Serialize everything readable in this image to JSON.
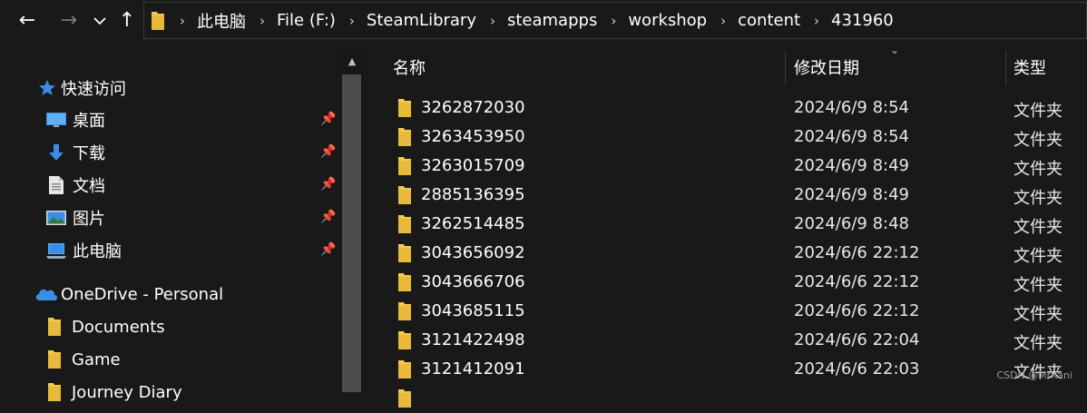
{
  "nav": {
    "back": "←",
    "forward": "→",
    "recent": "⌄",
    "up": "↑"
  },
  "breadcrumb": [
    "此电脑",
    "File (F:)",
    "SteamLibrary",
    "steamapps",
    "workshop",
    "content",
    "431960"
  ],
  "sidebar": {
    "quick_access": "快速访问",
    "pinned": [
      {
        "label": "桌面",
        "icon": "desktop-icon"
      },
      {
        "label": "下载",
        "icon": "download-icon"
      },
      {
        "label": "文档",
        "icon": "document-icon"
      },
      {
        "label": "图片",
        "icon": "picture-icon"
      },
      {
        "label": "此电脑",
        "icon": "computer-icon"
      }
    ],
    "onedrive": "OneDrive - Personal",
    "onedrive_items": [
      "Documents",
      "Game",
      "Journey Diary"
    ]
  },
  "columns": {
    "name": "名称",
    "date": "修改日期",
    "type": "类型"
  },
  "files": [
    {
      "name": "3262872030",
      "date": "2024/6/9 8:54",
      "type": "文件夹"
    },
    {
      "name": "3263453950",
      "date": "2024/6/9 8:54",
      "type": "文件夹"
    },
    {
      "name": "3263015709",
      "date": "2024/6/9 8:49",
      "type": "文件夹"
    },
    {
      "name": "2885136395",
      "date": "2024/6/9 8:49",
      "type": "文件夹"
    },
    {
      "name": "3262514485",
      "date": "2024/6/9 8:48",
      "type": "文件夹"
    },
    {
      "name": "3043656092",
      "date": "2024/6/6 22:12",
      "type": "文件夹"
    },
    {
      "name": "3043666706",
      "date": "2024/6/6 22:12",
      "type": "文件夹"
    },
    {
      "name": "3043685115",
      "date": "2024/6/6 22:12",
      "type": "文件夹"
    },
    {
      "name": "3121422498",
      "date": "2024/6/6 22:04",
      "type": "文件夹"
    },
    {
      "name": "3121412091",
      "date": "2024/6/6 22:03",
      "type": "文件夹"
    }
  ],
  "watermark": "CSDN @MrKani",
  "colors": {
    "background": "#191919",
    "folder": "#f2c94c",
    "accent_blue": "#3a8ee6"
  }
}
